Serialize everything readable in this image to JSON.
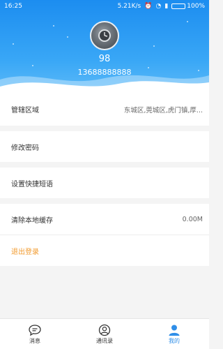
{
  "status_bar": {
    "time": "16:25",
    "speed": "5.21K/s",
    "battery": "100%",
    "battery_level": 1.0
  },
  "profile": {
    "name": "98",
    "phone": "13688888888"
  },
  "settings": {
    "region_label": "管辖区域",
    "region_value": "东城区,莞城区,虎门镇,厚...",
    "change_password": "修改密码",
    "quick_phrases": "设置快捷短语",
    "clear_cache_label": "清除本地缓存",
    "clear_cache_value": "0.00M",
    "logout": "退出登录"
  },
  "bottom_nav": {
    "tabs": [
      {
        "label": "消息"
      },
      {
        "label": "通讯录"
      },
      {
        "label": "我的"
      }
    ]
  },
  "colors": {
    "header_top": "#1c8df0",
    "accent": "#2f8ee8",
    "logout": "#f29b2f"
  }
}
